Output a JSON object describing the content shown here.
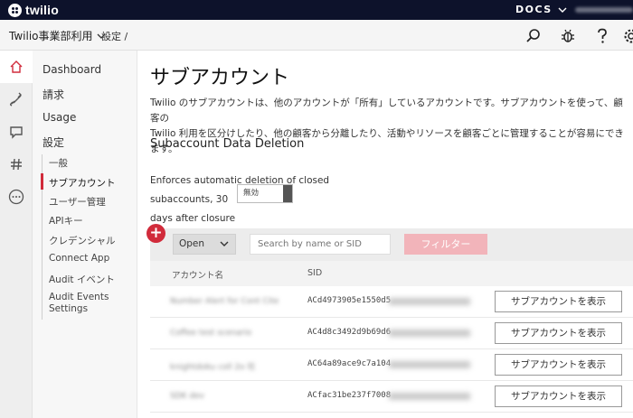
{
  "topbar": {
    "logo_text": "twilio",
    "docs_label": "DOCS"
  },
  "subbar": {
    "project_name": "Twilio事業部利用",
    "breadcrumb": "設定 /"
  },
  "nav": {
    "items": [
      {
        "label": "Dashboard"
      },
      {
        "label": "請求"
      },
      {
        "label": "Usage"
      },
      {
        "label": "設定"
      }
    ],
    "sub_items": [
      {
        "label": "一般"
      },
      {
        "label": "サブアカウント"
      },
      {
        "label": "ユーザー管理"
      },
      {
        "label": "APIキー"
      },
      {
        "label": "クレデンシャル"
      },
      {
        "label": "Connect App"
      },
      {
        "label": "Audit イベント"
      },
      {
        "label": "Audit Events"
      },
      {
        "label": "Settings"
      }
    ]
  },
  "main": {
    "title": "サブアカウント",
    "description_line1": "Twilio のサブアカウントは、他のアカウントが「所有」しているアカウントです。サブアカウントを使って、顧客の",
    "description_line2": "Twilio 利用を区分けしたり、他の顧客から分離したり、活動やリソースを顧客ごとに管理することが容易にできます。",
    "section_title": "Subaccount Data Deletion",
    "enforce_line1": "Enforces automatic deletion of closed subaccounts, 30",
    "enforce_line2": "days after closure",
    "toggle_label": "無効",
    "add_symbol": "+",
    "status_select": "Open",
    "search_placeholder": "Search by name or SID",
    "filter_label": "フィルター",
    "col_name": "アカウント名",
    "col_sid": "SID",
    "rows": [
      {
        "name": "Number Alert for Cont Cite",
        "sid": "ACd4973905e1550d5",
        "button": "サブアカウントを表示"
      },
      {
        "name": "Coffee test scenario",
        "sid": "AC4d8c3492d9b69d6",
        "button": "サブアカウントを表示"
      },
      {
        "name": "knightdoku coll 2o 社",
        "sid": "AC64a89ace9c7a104",
        "button": "サブアカウントを表示"
      },
      {
        "name": "SDK dev",
        "sid": "ACfac31be237f7008",
        "button": "サブアカウントを表示"
      }
    ]
  },
  "colors": {
    "topbar": "#0d122b",
    "accent_red": "#d12b3b",
    "filter_pink": "#f2b4ba"
  }
}
